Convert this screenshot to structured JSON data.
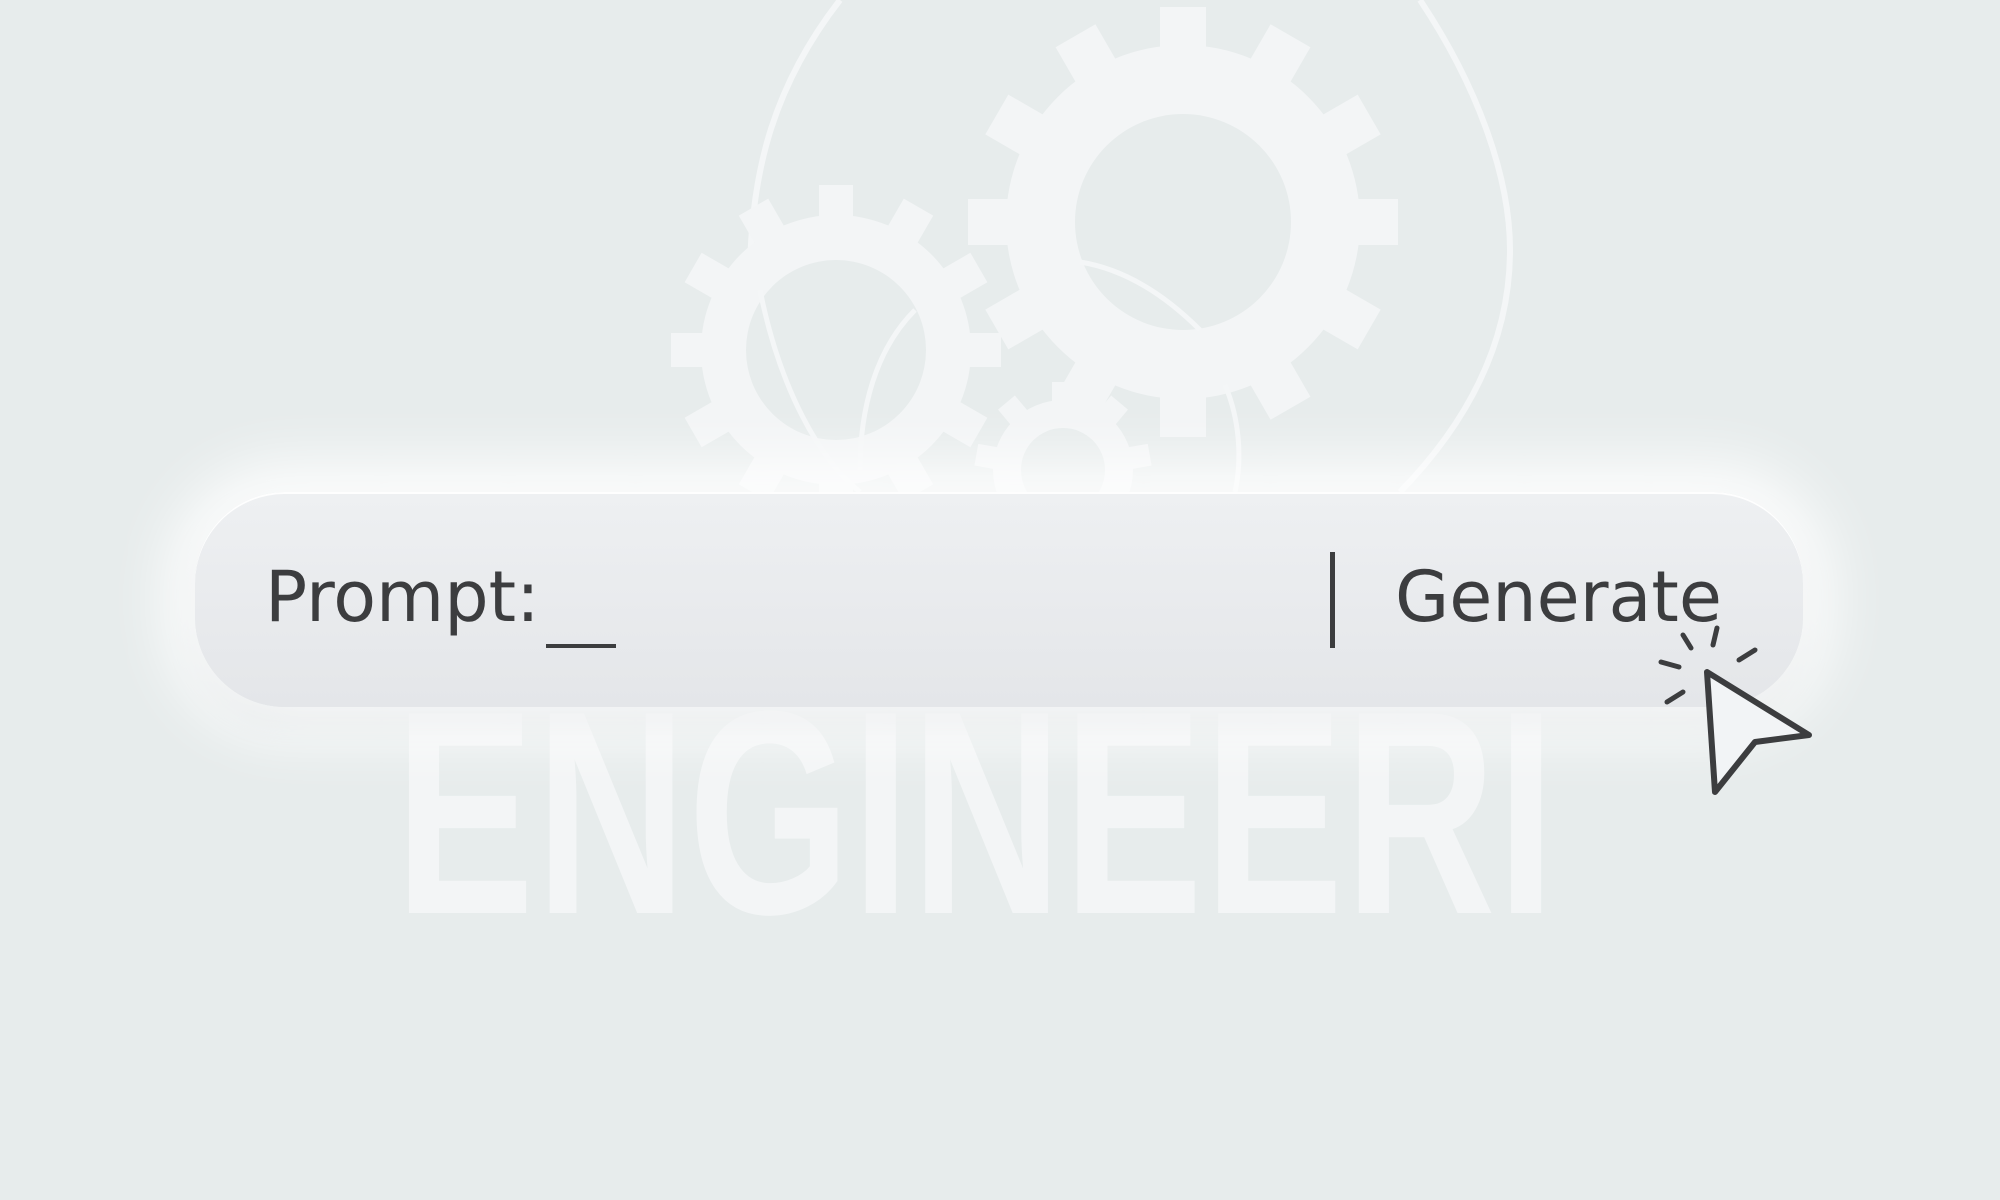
{
  "watermark": {
    "word": "ENGINEERING"
  },
  "prompt_bar": {
    "label": "Prompt:",
    "input_value": "",
    "button_label": "Generate"
  },
  "icons": {
    "gears": "gears-icon",
    "cursor": "arrow-cursor-icon"
  },
  "colors": {
    "background": "#e7ecec",
    "text": "#3c3d3f",
    "watermark": "#f3f5f6"
  }
}
